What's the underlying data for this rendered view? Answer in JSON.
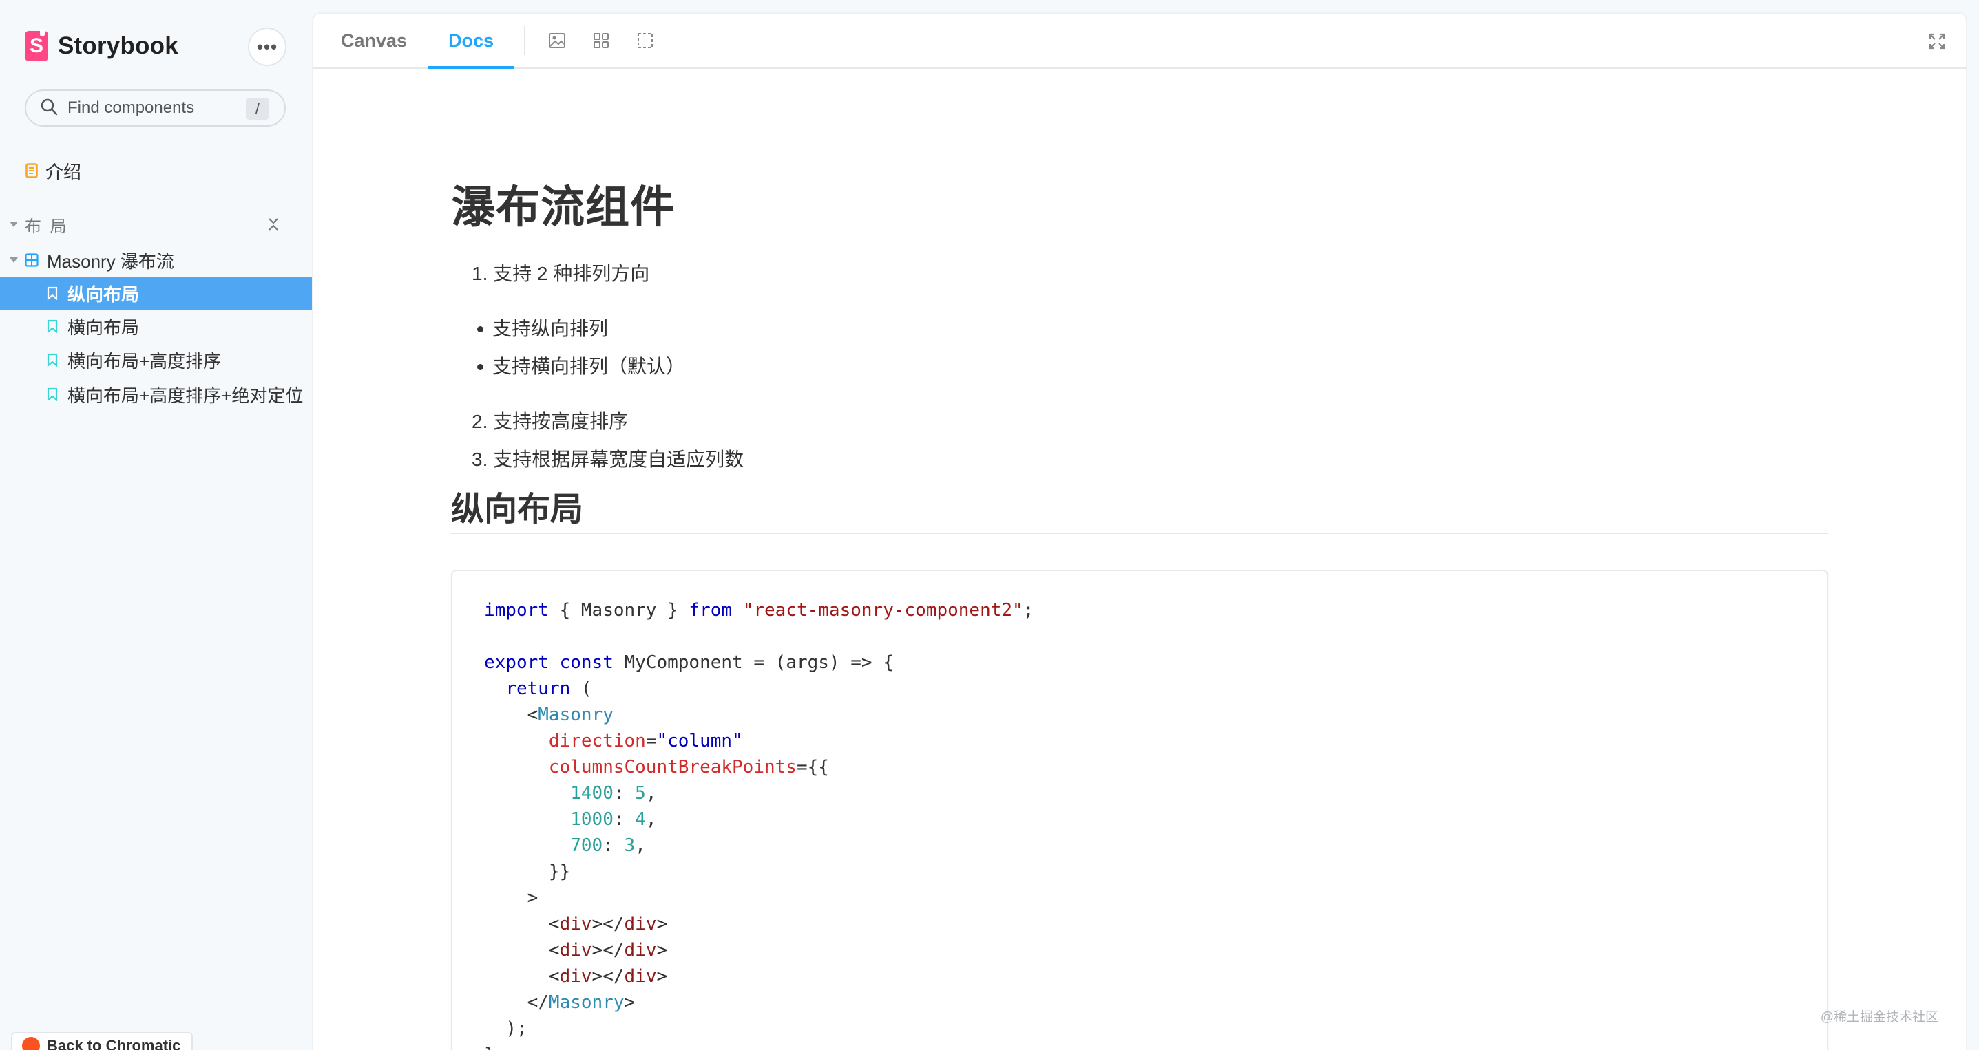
{
  "sidebar": {
    "brand": "Storybook",
    "more_label": "•••",
    "search_placeholder": "Find components",
    "search_shortcut": "/",
    "intro_label": "介绍",
    "group_label": "布 局",
    "component_label": "Masonry 瀑布流",
    "stories": [
      {
        "label": "纵向布局",
        "selected": true
      },
      {
        "label": "横向布局",
        "selected": false
      },
      {
        "label": "横向布局+高度排序",
        "selected": false
      },
      {
        "label": "横向布局+高度排序+绝对定位",
        "selected": false
      }
    ],
    "chromatic_label": "Back to Chromatic"
  },
  "toolbar": {
    "tabs": [
      {
        "label": "Canvas",
        "active": false
      },
      {
        "label": "Docs",
        "active": true
      }
    ],
    "icons": [
      "image-icon",
      "grid-icon",
      "outline-icon",
      "fullscreen-icon"
    ]
  },
  "doc": {
    "title": "瀑布流组件",
    "item1": "1. 支持 2 种排列方向",
    "bullets": [
      "支持纵向排列",
      "支持横向排列（默认）"
    ],
    "item2": "2. 支持按高度排序",
    "item3": "3. 支持根据屏幕宽度自适应列数",
    "section_title": "纵向布局"
  },
  "code": {
    "import_kw": "import",
    "import_names": " { Masonry } ",
    "from_kw": "from",
    "module": "\"react-masonry-component2\"",
    "semicolon": ";",
    "export_kw": "export",
    "const_kw": "const",
    "component_decl": " MyComponent = (args) => {",
    "return_kw": "return",
    "return_paren": " (",
    "masonry_tag": "Masonry",
    "direction_attr": "direction",
    "direction_value": "\"column\"",
    "breakpoints_attr": "columnsCountBreakPoints",
    "breakpoints_open": "={{",
    "bp": [
      {
        "key": "1400",
        "value": "5"
      },
      {
        "key": "1000",
        "value": "4"
      },
      {
        "key": "700",
        "value": "3"
      }
    ],
    "breakpoints_close": "}}",
    "gt": ">",
    "div_tag": "div",
    "close_paren": ");",
    "close_brace": "}"
  },
  "colors": {
    "accent": "#1ea7fd",
    "selected_bg": "#4fa7f3",
    "brand": "#ff4785"
  },
  "watermark": "@稀土掘金技术社区"
}
